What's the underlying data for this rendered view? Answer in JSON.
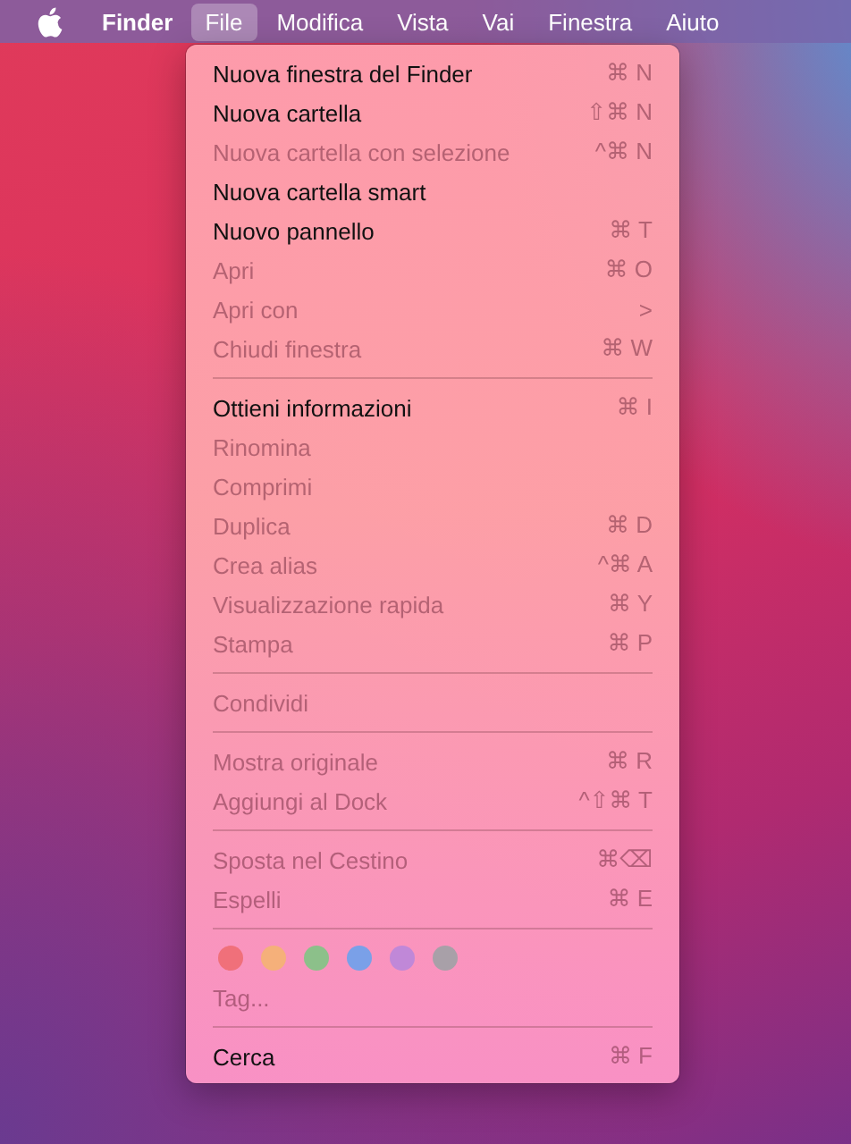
{
  "menu_bar": {
    "app_name": "Finder",
    "menus": [
      {
        "label": "File",
        "selected": true
      },
      {
        "label": "Modifica",
        "selected": false
      },
      {
        "label": "Vista",
        "selected": false
      },
      {
        "label": "Vai",
        "selected": false
      },
      {
        "label": "Finestra",
        "selected": false
      },
      {
        "label": "Aiuto",
        "selected": false
      }
    ]
  },
  "file_menu": {
    "items": [
      {
        "kind": "item",
        "label": "Nuova finestra del Finder",
        "shortcut": "⌘ N",
        "disabled": false
      },
      {
        "kind": "item",
        "label": "Nuova cartella",
        "shortcut": "⇧⌘ N",
        "disabled": false
      },
      {
        "kind": "item",
        "label": "Nuova cartella con selezione",
        "shortcut": "^⌘ N",
        "disabled": true
      },
      {
        "kind": "item",
        "label": "Nuova cartella smart",
        "disabled": false
      },
      {
        "kind": "item",
        "label": "Nuovo pannello",
        "shortcut": "⌘ T",
        "disabled": false
      },
      {
        "kind": "item",
        "label": "Apri",
        "shortcut": "⌘ O",
        "disabled": true
      },
      {
        "kind": "item",
        "label": "Apri con",
        "shortcut": ">",
        "disabled": true
      },
      {
        "kind": "item",
        "label": "Chiudi finestra",
        "shortcut": "⌘ W",
        "disabled": true
      },
      {
        "kind": "separator"
      },
      {
        "kind": "item",
        "label": "Ottieni informazioni",
        "shortcut": "⌘ I",
        "disabled": false
      },
      {
        "kind": "item",
        "label": "Rinomina",
        "disabled": true
      },
      {
        "kind": "item",
        "label": "Comprimi",
        "disabled": true
      },
      {
        "kind": "item",
        "label": "Duplica",
        "shortcut": "⌘ D",
        "disabled": true
      },
      {
        "kind": "item",
        "label": "Crea alias",
        "shortcut": "^⌘ A",
        "disabled": true
      },
      {
        "kind": "item",
        "label": "Visualizzazione rapida",
        "shortcut": "⌘ Y",
        "disabled": true
      },
      {
        "kind": "item",
        "label": "Stampa",
        "shortcut": "⌘ P",
        "disabled": true
      },
      {
        "kind": "separator"
      },
      {
        "kind": "item",
        "label": "Condividi",
        "disabled": true
      },
      {
        "kind": "separator"
      },
      {
        "kind": "item",
        "label": "Mostra originale",
        "shortcut": "⌘ R",
        "disabled": true
      },
      {
        "kind": "item",
        "label": "Aggiungi al Dock",
        "shortcut": "^⇧⌘ T",
        "disabled": true
      },
      {
        "kind": "separator"
      },
      {
        "kind": "item",
        "label": "Sposta nel Cestino",
        "shortcut": "⌘⌫",
        "disabled": true
      },
      {
        "kind": "item",
        "label": "Espelli",
        "shortcut": "⌘ E",
        "disabled": true
      },
      {
        "kind": "separator"
      },
      {
        "kind": "tags",
        "tags": [
          {
            "color": "#f0707a"
          },
          {
            "color": "#f5b07a"
          },
          {
            "color": "#8cc08a"
          },
          {
            "color": "#7aa0e8"
          },
          {
            "color": "#c088d8"
          },
          {
            "color": "#a8a0a8"
          }
        ]
      },
      {
        "kind": "item",
        "label": "Tag...",
        "disabled": true
      },
      {
        "kind": "separator"
      },
      {
        "kind": "item",
        "label": "Cerca",
        "shortcut": "⌘ F",
        "disabled": false
      }
    ]
  }
}
